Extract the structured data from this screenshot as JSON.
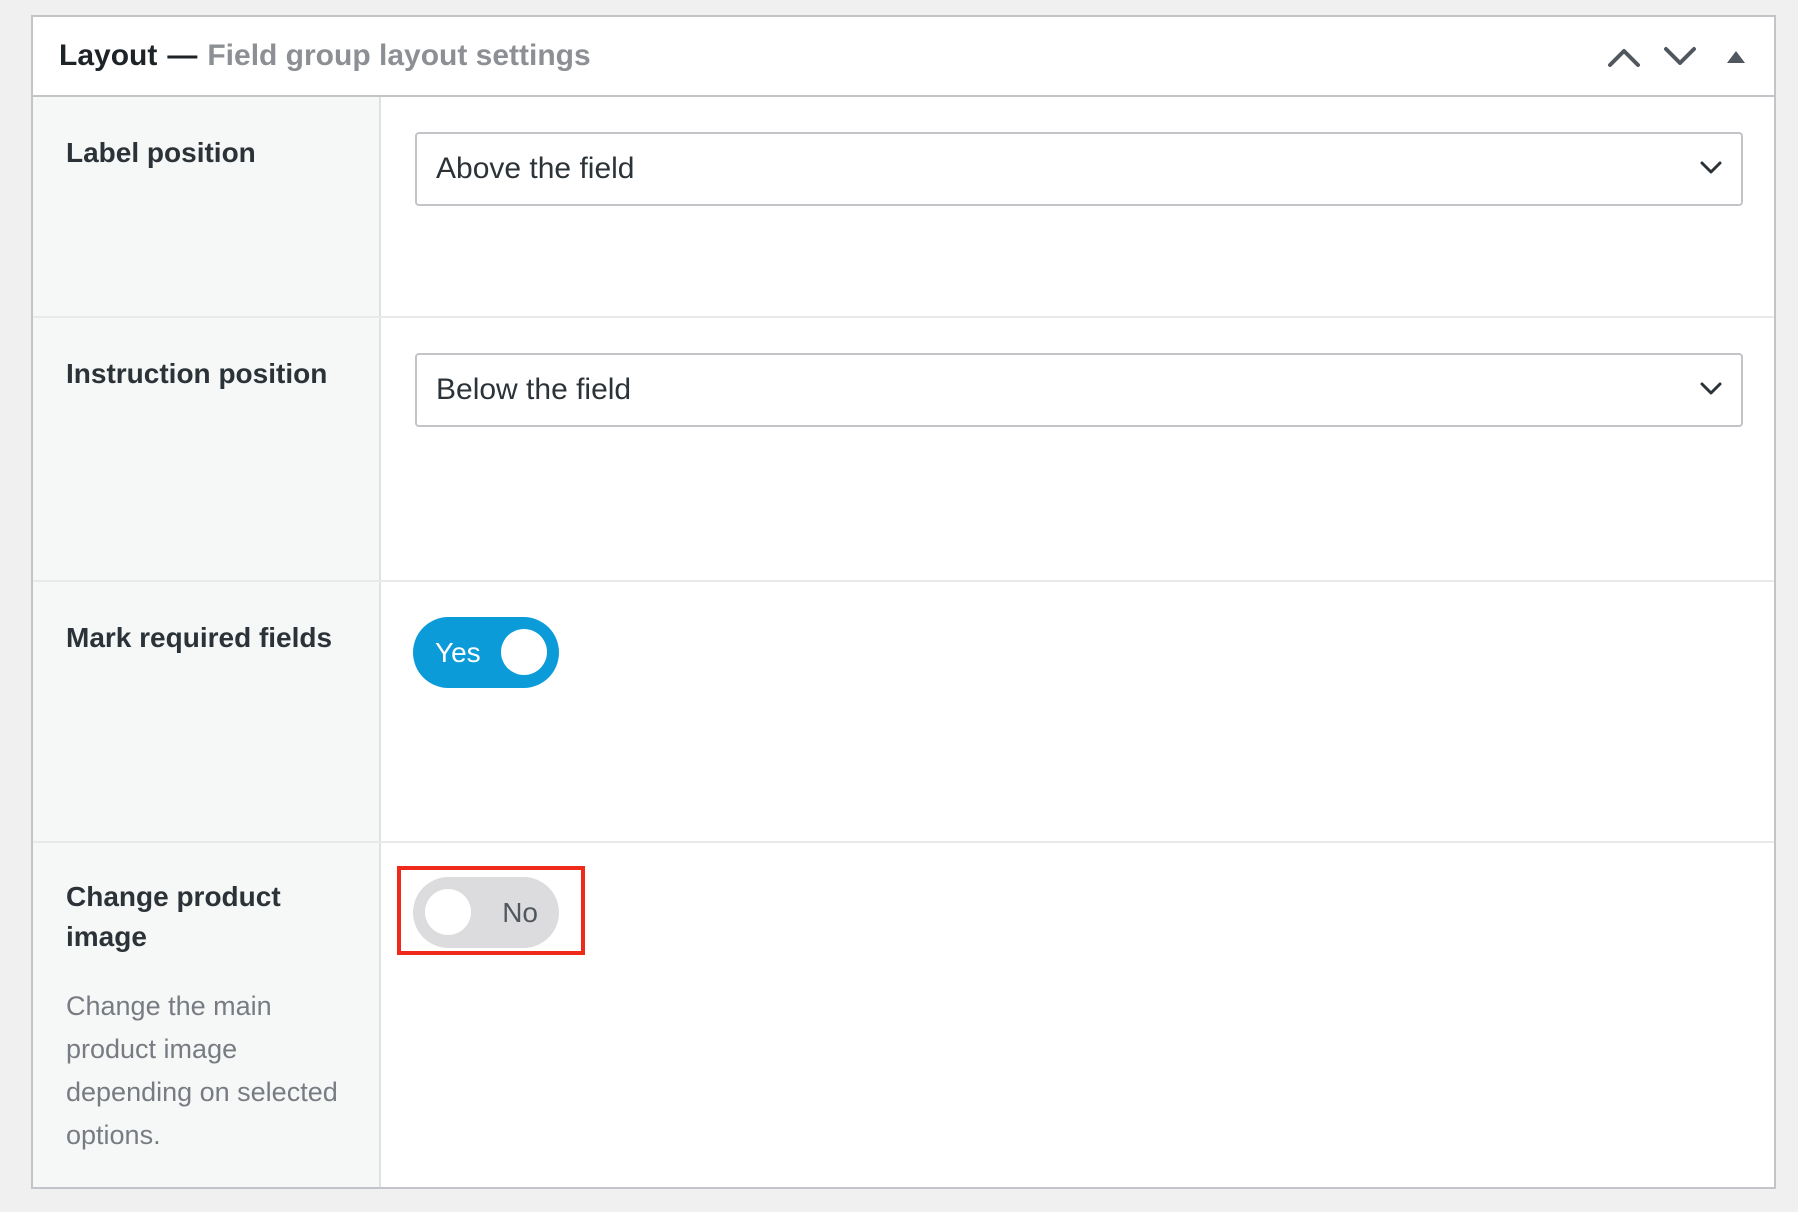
{
  "header": {
    "title": "Layout",
    "separator": "—",
    "subtitle": "Field group layout settings",
    "icons": [
      "chevron-up-icon",
      "chevron-down-icon",
      "triangle-up-icon"
    ]
  },
  "rows": [
    {
      "label": "Label position",
      "type": "select",
      "value": "Above the field"
    },
    {
      "label": "Instruction position",
      "type": "select",
      "value": "Below the field"
    },
    {
      "label": "Mark required fields",
      "type": "toggle",
      "value": "Yes",
      "checked": true
    },
    {
      "label": "Change product image",
      "type": "toggle",
      "value": "No",
      "checked": false,
      "description": "Change the main product image depending on selected options."
    }
  ],
  "colors": {
    "toggle_on": "#0b9bd9",
    "toggle_off": "#dcdcde",
    "highlight": "#f02a1a"
  }
}
